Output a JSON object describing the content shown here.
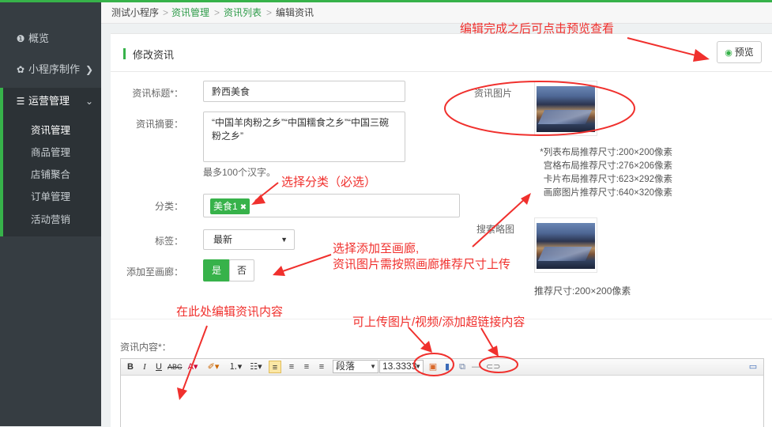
{
  "breadcrumb": [
    "测试小程序",
    "资讯管理",
    "资讯列表",
    "编辑资讯"
  ],
  "sidebar": {
    "items": [
      {
        "label": "概览",
        "icon": "info-circle-icon"
      },
      {
        "label": "小程序制作",
        "icon": "gear-icon"
      },
      {
        "label": "运营管理",
        "icon": "list-icon"
      }
    ],
    "sub_items": [
      "资讯管理",
      "商品管理",
      "店铺聚合",
      "订单管理",
      "活动营销"
    ]
  },
  "panel": {
    "title": "修改资讯",
    "preview_button": "预览"
  },
  "form": {
    "title_label": "资讯标题*：",
    "title_value": "黔西美食",
    "summary_label": "资讯摘要：",
    "summary_value": "“中国羊肉粉之乡”“中国糯食之乡”“中国三碗粉之乡”",
    "summary_hint": "最多100个汉字。",
    "category_label": "分类：",
    "category_tag": "美食1",
    "tags_label": "标签：",
    "tags_value": "最新",
    "gallery_label": "添加至画廊：",
    "gallery_yes": "是",
    "gallery_no": "否",
    "image_label": "资讯图片",
    "image_specs": [
      "*列表布局推荐尺寸:200×200像素",
      "宫格布局推荐尺寸:276×206像素",
      "卡片布局推荐尺寸:623×292像素",
      "画廊图片推荐尺寸:640×320像素"
    ],
    "thumb_label": "搜索略图",
    "thumb_hint": "推荐尺寸:200×200像素",
    "content_label": "资讯内容*："
  },
  "editor": {
    "paragraph_select": "段落",
    "font_size_select": "13.3333"
  },
  "annotations": {
    "preview_note": "编辑完成之后可点击预览查看",
    "category_note": "选择分类（必选）",
    "gallery_note_1": "选择添加至画廊,",
    "gallery_note_2": "资讯图片需按照画廊推荐尺寸上传",
    "content_note": "在此处编辑资讯内容",
    "upload_note": "可上传图片/视频/添加超链接内容",
    "color": "#f0302d"
  },
  "colors": {
    "accent": "#37b24a",
    "sidebar_bg": "#363d42"
  }
}
